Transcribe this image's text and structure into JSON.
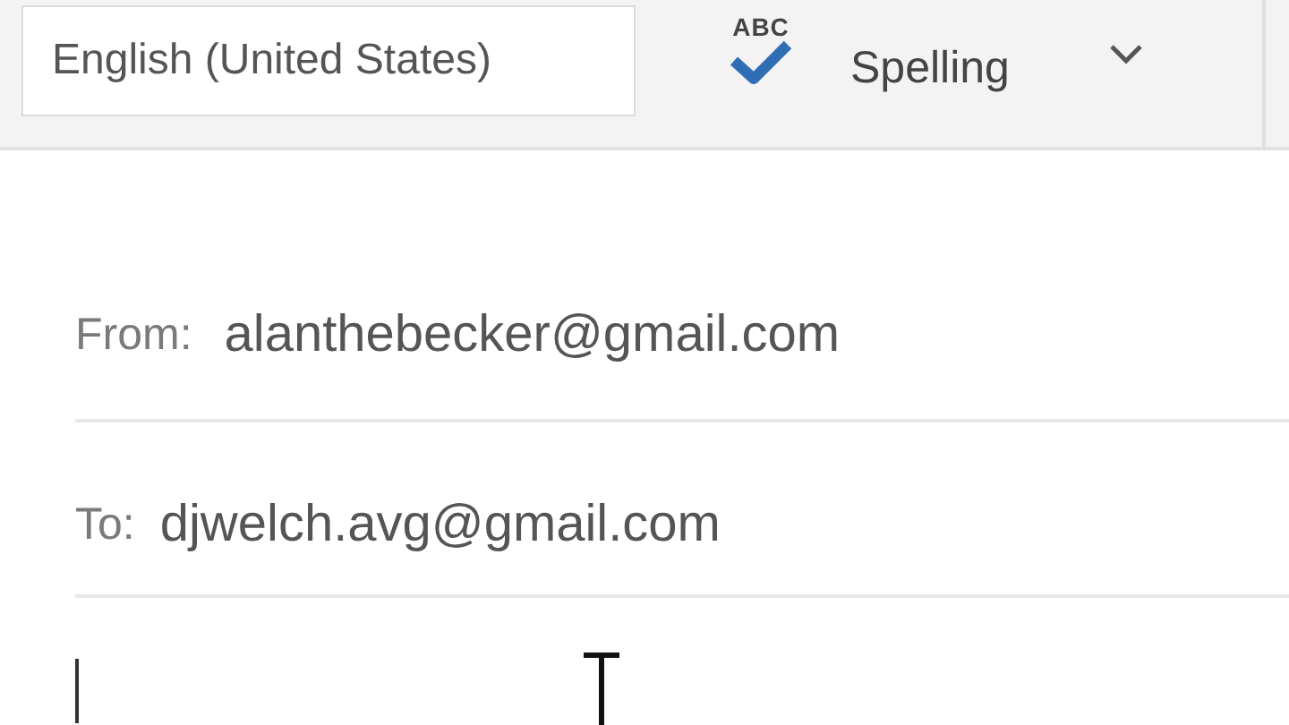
{
  "toolbar": {
    "language": "English (United States)",
    "spelling_icon_text": "ABC",
    "spelling_label": "Spelling"
  },
  "fields": [
    {
      "kind": "from",
      "label": "From:",
      "value": "alanthebecker@gmail.com"
    },
    {
      "kind": "to",
      "label": "To:",
      "value": "djwelch.avg@gmail.com"
    }
  ],
  "body": {
    "focused": true
  }
}
